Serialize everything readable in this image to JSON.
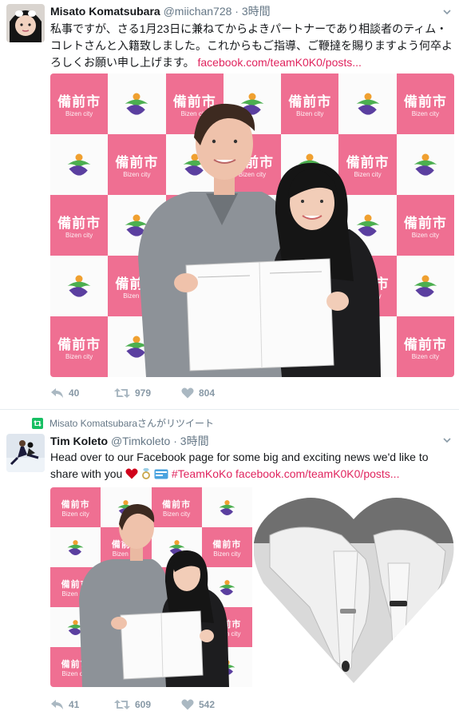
{
  "tweet1": {
    "name": "Misato Komatsubara",
    "handle": "@miichan728",
    "separator": "·",
    "time": "3時間",
    "text": "私事ですが、さる1月23日に兼ねてからよきパートナーであり相談者のティム・コレトさんと入籍致しました。これからもご指導、ご鞭撻を賜りますよう何卒よろしくお願い申し上げます。",
    "link": "facebook.com/teamK0K0/posts...",
    "backdrop_kanji": "備前市",
    "backdrop_sub": "Bizen city",
    "replies": "40",
    "retweets": "979",
    "likes": "804"
  },
  "tweet2": {
    "retweet_context": "Misato Komatsubaraさんがリツイート",
    "name": "Tim Koleto",
    "handle": "@Timkoleto",
    "separator": "·",
    "time": "3時間",
    "text": "Head over to our Facebook page for some big and exciting news we'd like to share with you",
    "hashtag": "#TeamKoKo",
    "link": "facebook.com/teamK0K0/posts...",
    "backdrop_kanji": "備前市",
    "backdrop_sub": "Bizen city",
    "replies": "41",
    "retweets": "609",
    "likes": "542"
  },
  "colors": {
    "link": "#e0245e",
    "action_gray": "#8899a6",
    "backdrop_pink": "#ef6f92",
    "retweet_green": "#17bf63"
  }
}
